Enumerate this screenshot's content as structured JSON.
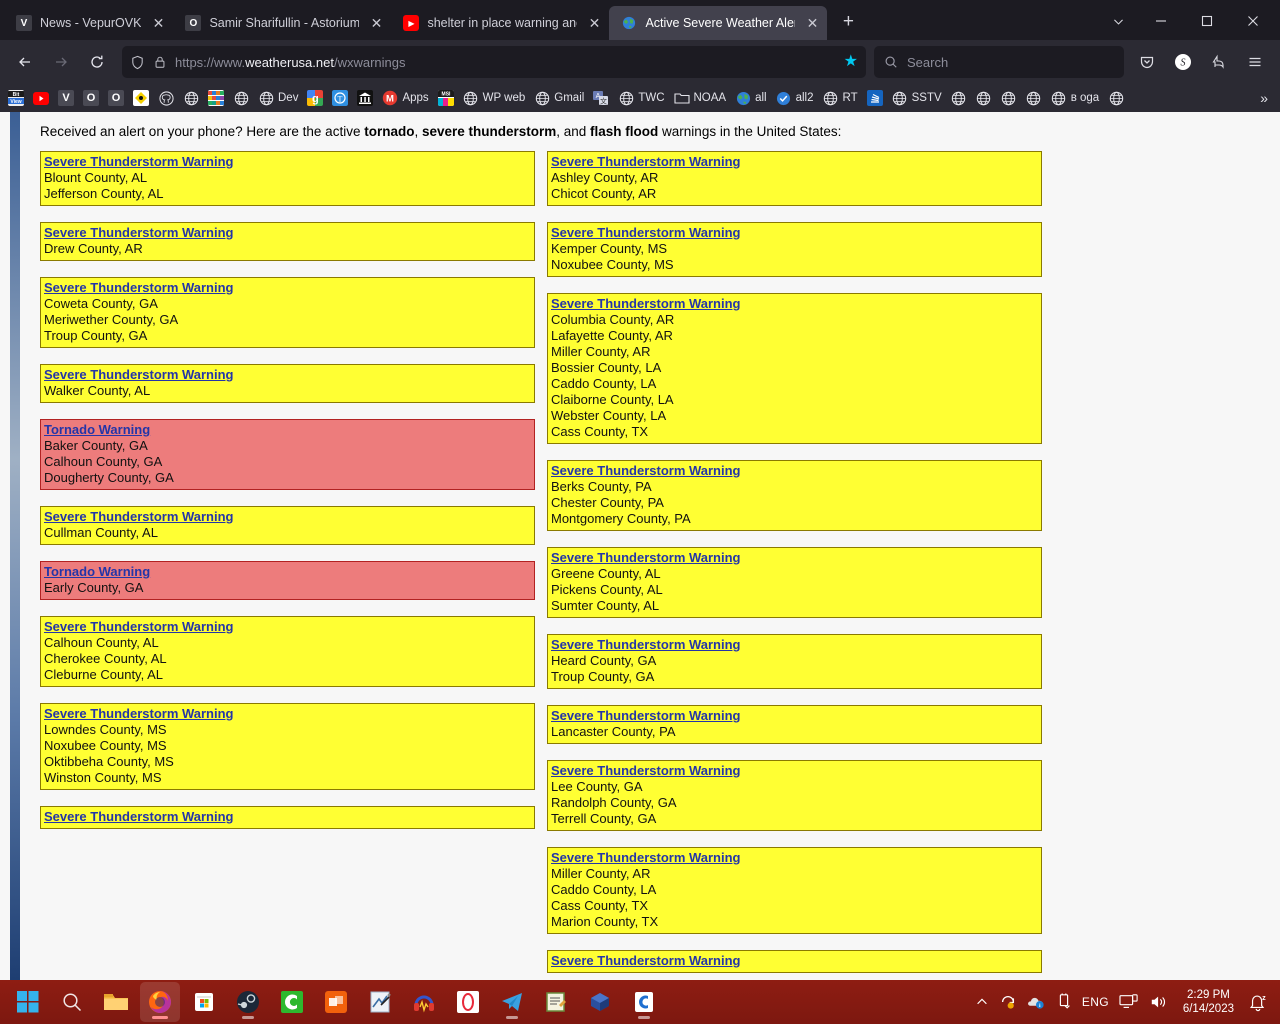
{
  "browser": {
    "tabs": [
      {
        "title": "News - VepurOVK",
        "icon": "vepurovk-favicon",
        "active": false
      },
      {
        "title": "Samir Sharifullin - Astorium",
        "icon": "astorium-favicon",
        "active": false
      },
      {
        "title": "shelter in place warning and ev",
        "icon": "youtube-favicon",
        "active": false
      },
      {
        "title": "Active Severe Weather Alerts in",
        "icon": "globe-favicon",
        "active": true
      }
    ],
    "new_tab_label": "+",
    "tab_list_label": "⌄",
    "window_controls": {
      "minimize": "–",
      "maximize": "❐",
      "close": "✕"
    },
    "nav": {
      "back": "←",
      "forward": "→",
      "reload": "⟳"
    },
    "url": {
      "prefix": "https://www.",
      "host": "weatherusa.net",
      "path": "/wxwarnings"
    },
    "url_full": "https://www.weatherusa.net/wxwarnings",
    "search_placeholder": "Search",
    "bookmark_star": "★",
    "toolbar_right": [
      {
        "name": "pocket-icon",
        "glyph": "▽"
      },
      {
        "name": "account-icon",
        "glyph": "S"
      },
      {
        "name": "extensions-icon",
        "glyph": "⤳"
      },
      {
        "name": "app-menu-icon",
        "glyph": "≡"
      }
    ],
    "bookmarks": [
      {
        "label": "",
        "icon": "bitview-icon"
      },
      {
        "label": "",
        "icon": "youtube-icon"
      },
      {
        "label": "",
        "icon": "vepurovk-icon"
      },
      {
        "label": "",
        "icon": "openvk-icon"
      },
      {
        "label": "",
        "icon": "openvk2-icon"
      },
      {
        "label": "",
        "icon": "yellow-diamond-icon"
      },
      {
        "label": "",
        "icon": "github-icon"
      },
      {
        "label": "",
        "icon": "globe-icon"
      },
      {
        "label": "",
        "icon": "tinkercad-icon"
      },
      {
        "label": "",
        "icon": "globe-icon"
      },
      {
        "label": "Dev",
        "icon": "globe-icon"
      },
      {
        "label": "",
        "icon": "google-icon"
      },
      {
        "label": "",
        "icon": "telegram-blue-icon"
      },
      {
        "label": "",
        "icon": "museum-icon"
      },
      {
        "label": "Apps",
        "icon": "gmail-m-icon"
      },
      {
        "label": "",
        "icon": "msi-icon"
      },
      {
        "label": "WP web",
        "icon": "globe-icon"
      },
      {
        "label": "Gmail",
        "icon": "globe-icon"
      },
      {
        "label": "",
        "icon": "translate-icon"
      },
      {
        "label": "TWC",
        "icon": "globe-icon"
      },
      {
        "label": "NOAA",
        "icon": "folder-icon"
      },
      {
        "label": "all",
        "icon": "globe-earth-icon"
      },
      {
        "label": "all2",
        "icon": "check-circle-icon"
      },
      {
        "label": "RT",
        "icon": "globe-icon"
      },
      {
        "label": "",
        "icon": "stackoverflow-icon"
      },
      {
        "label": "SSTV",
        "icon": "globe-icon"
      },
      {
        "label": "",
        "icon": "globe-icon"
      },
      {
        "label": "",
        "icon": "globe-icon"
      },
      {
        "label": "",
        "icon": "globe-icon"
      },
      {
        "label": "",
        "icon": "globe-icon"
      },
      {
        "label": "в oga",
        "icon": "globe-icon"
      },
      {
        "label": "",
        "icon": "globe-icon"
      }
    ],
    "bookmarks_overflow": "»"
  },
  "page": {
    "intro_prefix": "Received an alert on your phone? Here are the active ",
    "intro_b1": "tornado",
    "intro_sep1": ", ",
    "intro_b2": "severe thunderstorm",
    "intro_sep2": ", and ",
    "intro_b3": "flash flood",
    "intro_suffix": " warnings in the United States:",
    "colors": {
      "severe_bg": "#ffff33",
      "tornado_bg": "#ed7c7c",
      "link": "#2435a8",
      "page_bg": "#f7f7f7"
    },
    "alerts_left": [
      {
        "type": "Severe Thunderstorm Warning",
        "kind": "severe",
        "counties": [
          "Blount County, AL",
          "Jefferson County, AL"
        ]
      },
      {
        "type": "Severe Thunderstorm Warning",
        "kind": "severe",
        "counties": [
          "Drew County, AR"
        ]
      },
      {
        "type": "Severe Thunderstorm Warning",
        "kind": "severe",
        "counties": [
          "Coweta County, GA",
          "Meriwether County, GA",
          "Troup County, GA"
        ]
      },
      {
        "type": "Severe Thunderstorm Warning",
        "kind": "severe",
        "counties": [
          "Walker County, AL"
        ]
      },
      {
        "type": "Tornado Warning",
        "kind": "tornado",
        "counties": [
          "Baker County, GA",
          "Calhoun County, GA",
          "Dougherty County, GA"
        ]
      },
      {
        "type": "Severe Thunderstorm Warning",
        "kind": "severe",
        "counties": [
          "Cullman County, AL"
        ]
      },
      {
        "type": "Tornado Warning",
        "kind": "tornado",
        "counties": [
          "Early County, GA"
        ]
      },
      {
        "type": "Severe Thunderstorm Warning",
        "kind": "severe",
        "counties": [
          "Calhoun County, AL",
          "Cherokee County, AL",
          "Cleburne County, AL"
        ]
      },
      {
        "type": "Severe Thunderstorm Warning",
        "kind": "severe",
        "counties": [
          "Lowndes County, MS",
          "Noxubee County, MS",
          "Oktibbeha County, MS",
          "Winston County, MS"
        ]
      },
      {
        "type": "Severe Thunderstorm Warning",
        "kind": "severe",
        "counties": []
      }
    ],
    "alerts_right": [
      {
        "type": "Severe Thunderstorm Warning",
        "kind": "severe",
        "counties": [
          "Ashley County, AR",
          "Chicot County, AR"
        ]
      },
      {
        "type": "Severe Thunderstorm Warning",
        "kind": "severe",
        "counties": [
          "Kemper County, MS",
          "Noxubee County, MS"
        ]
      },
      {
        "type": "Severe Thunderstorm Warning",
        "kind": "severe",
        "counties": [
          "Columbia County, AR",
          "Lafayette County, AR",
          "Miller County, AR",
          "Bossier County, LA",
          "Caddo County, LA",
          "Claiborne County, LA",
          "Webster County, LA",
          "Cass County, TX"
        ]
      },
      {
        "type": "Severe Thunderstorm Warning",
        "kind": "severe",
        "counties": [
          "Berks County, PA",
          "Chester County, PA",
          "Montgomery County, PA"
        ]
      },
      {
        "type": "Severe Thunderstorm Warning",
        "kind": "severe",
        "counties": [
          "Greene County, AL",
          "Pickens County, AL",
          "Sumter County, AL"
        ]
      },
      {
        "type": "Severe Thunderstorm Warning",
        "kind": "severe",
        "counties": [
          "Heard County, GA",
          "Troup County, GA"
        ]
      },
      {
        "type": "Severe Thunderstorm Warning",
        "kind": "severe",
        "counties": [
          "Lancaster County, PA"
        ]
      },
      {
        "type": "Severe Thunderstorm Warning",
        "kind": "severe",
        "counties": [
          "Lee County, GA",
          "Randolph County, GA",
          "Terrell County, GA"
        ]
      },
      {
        "type": "Severe Thunderstorm Warning",
        "kind": "severe",
        "counties": [
          "Miller County, AR",
          "Caddo County, LA",
          "Cass County, TX",
          "Marion County, TX"
        ]
      },
      {
        "type": "Severe Thunderstorm Warning",
        "kind": "severe",
        "counties": []
      }
    ]
  },
  "taskbar": {
    "apps": [
      {
        "name": "start-button",
        "icon": "windows-logo"
      },
      {
        "name": "search-taskbar-button",
        "icon": "magnifier"
      },
      {
        "name": "file-explorer-button",
        "icon": "folder"
      },
      {
        "name": "firefox-button",
        "icon": "firefox",
        "active": true
      },
      {
        "name": "microsoft-store-button",
        "icon": "store"
      },
      {
        "name": "steam-button",
        "icon": "steam"
      },
      {
        "name": "calculator-button",
        "icon": "green-c"
      },
      {
        "name": "office-button",
        "icon": "office"
      },
      {
        "name": "paint-button",
        "icon": "paint"
      },
      {
        "name": "audacity-button",
        "icon": "audacity"
      },
      {
        "name": "opera-button",
        "icon": "opera"
      },
      {
        "name": "telegram-button",
        "icon": "telegram"
      },
      {
        "name": "notepad-button",
        "icon": "notepad"
      },
      {
        "name": "unknown-blue-button",
        "icon": "blue-gem"
      },
      {
        "name": "coolterm-button",
        "icon": "blue-c"
      }
    ],
    "tray": {
      "chevron": "∧",
      "items": [
        "update-icon",
        "onedrive-icon",
        "usb-eject-icon"
      ],
      "language": "ENG",
      "network_icon": "monitor-icon",
      "volume_icon": "speaker-icon",
      "time": "2:29 PM",
      "date": "6/14/2023",
      "notification_icon": "bell-icon"
    }
  }
}
